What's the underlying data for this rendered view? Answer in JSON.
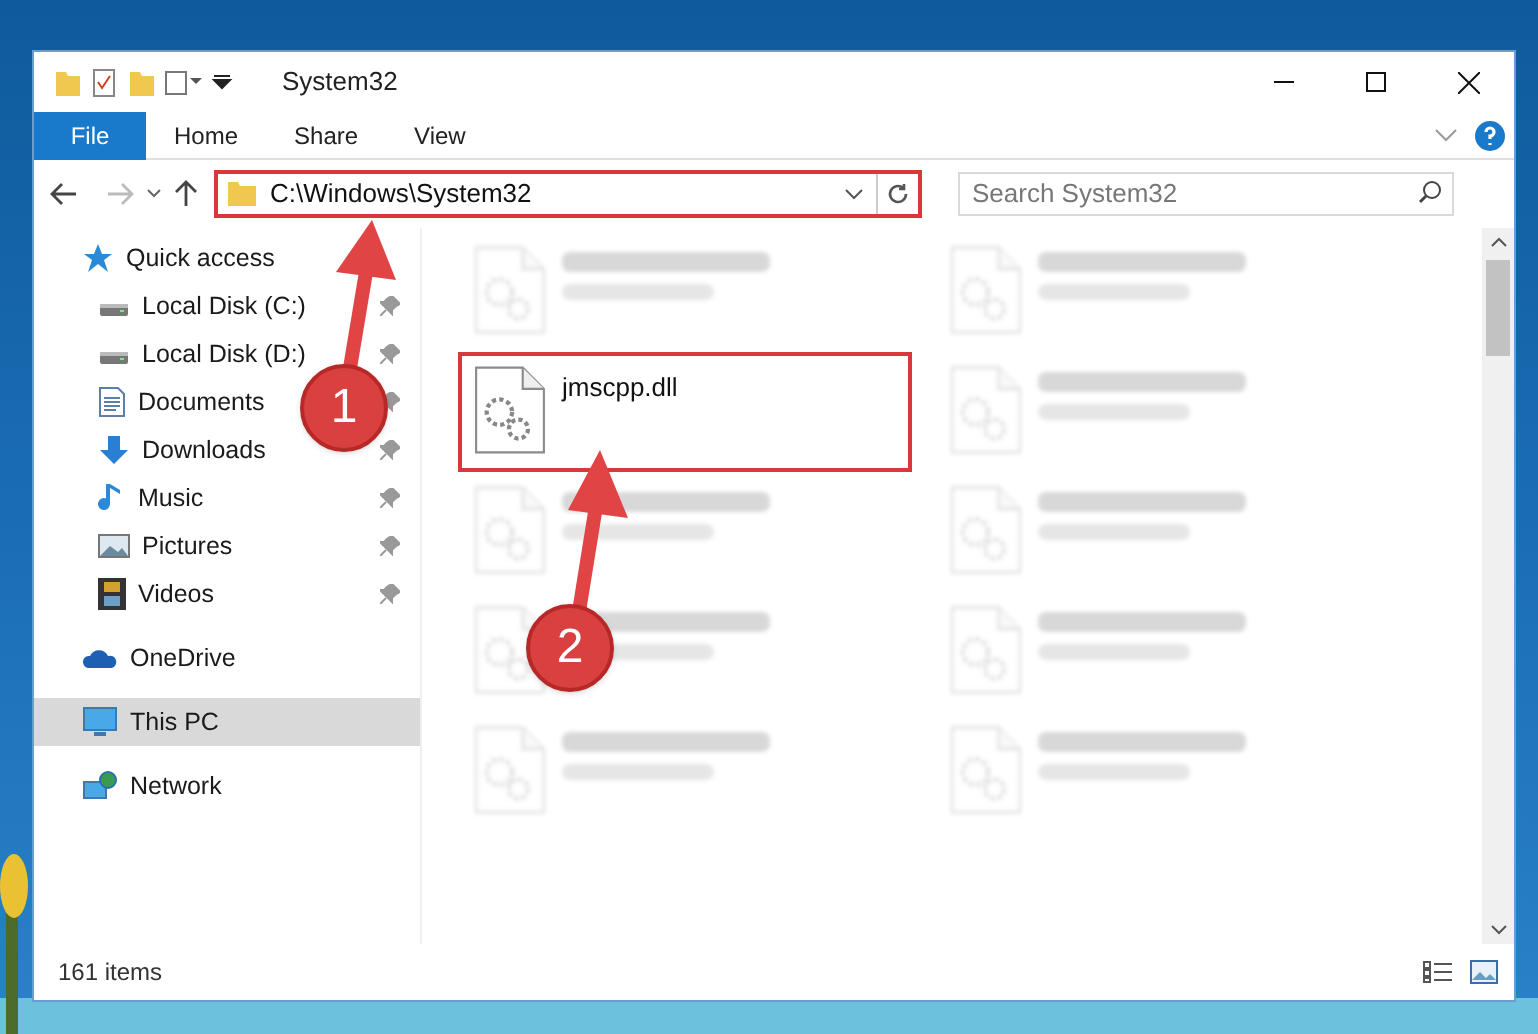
{
  "window": {
    "title": "System32"
  },
  "ribbon_tabs": [
    {
      "label": "File",
      "selected": true
    },
    {
      "label": "Home",
      "selected": false
    },
    {
      "label": "Share",
      "selected": false
    },
    {
      "label": "View",
      "selected": false
    }
  ],
  "address": {
    "path": "C:\\Windows\\System32",
    "annotated": true
  },
  "search": {
    "placeholder": "Search System32"
  },
  "sidebar": [
    {
      "label": "Quick access",
      "kind": "star",
      "selected": false,
      "children": [
        {
          "label": "Local Disk (C:)",
          "kind": "drive",
          "pinned": true,
          "selected": false
        },
        {
          "label": "Local Disk (D:)",
          "kind": "drive",
          "pinned": true,
          "selected": false
        },
        {
          "label": "Documents",
          "kind": "document",
          "pinned": true,
          "selected": false
        },
        {
          "label": "Downloads",
          "kind": "download",
          "pinned": true,
          "selected": false
        },
        {
          "label": "Music",
          "kind": "music",
          "pinned": true,
          "selected": false
        },
        {
          "label": "Pictures",
          "kind": "pictures",
          "pinned": true,
          "selected": false
        },
        {
          "label": "Videos",
          "kind": "videos",
          "pinned": true,
          "selected": false
        }
      ]
    },
    {
      "label": "OneDrive",
      "kind": "cloud",
      "selected": false
    },
    {
      "label": "This PC",
      "kind": "pc",
      "selected": true
    },
    {
      "label": "Network",
      "kind": "network",
      "selected": false
    }
  ],
  "files": [
    {
      "kind": "blurred"
    },
    {
      "kind": "blurred"
    },
    {
      "kind": "file",
      "name": "jmscpp.dll",
      "annotated": true
    },
    {
      "kind": "blurred"
    },
    {
      "kind": "blurred"
    },
    {
      "kind": "blurred"
    },
    {
      "kind": "blurred"
    },
    {
      "kind": "blurred"
    },
    {
      "kind": "blurred"
    },
    {
      "kind": "blurred"
    }
  ],
  "status_bar": {
    "count": "161 items"
  },
  "callouts": [
    {
      "number": "1"
    },
    {
      "number": "2"
    }
  ]
}
